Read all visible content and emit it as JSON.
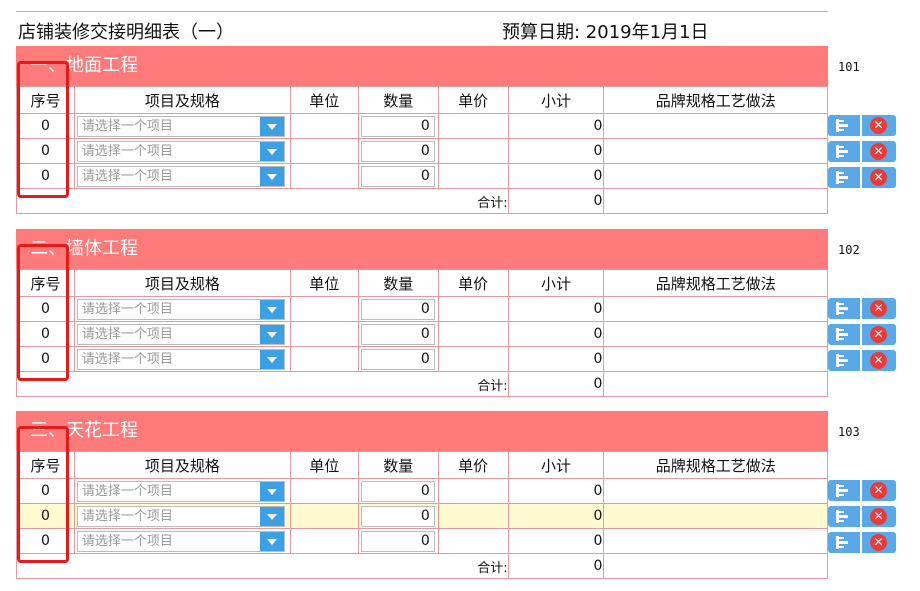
{
  "header": {
    "shop_name": "店铺装修交接明细表（一）",
    "budget_date": "预算日期:  2019年1月1日"
  },
  "columns": [
    "序号",
    "项目及规格",
    "单位",
    "数量",
    "单价",
    "小计",
    "品牌规格工艺做法"
  ],
  "select_placeholder": "请选择一个项目",
  "total_label": "合计:",
  "sections": [
    {
      "title": "一、地面工程",
      "code": "101",
      "rows": [
        {
          "seq": "0",
          "qty": "0",
          "subtotal": "0"
        },
        {
          "seq": "0",
          "qty": "0",
          "subtotal": "0"
        },
        {
          "seq": "0",
          "qty": "0",
          "subtotal": "0"
        }
      ],
      "total": "0"
    },
    {
      "title": "二、墙体工程",
      "code": "102",
      "rows": [
        {
          "seq": "0",
          "qty": "0",
          "subtotal": "0"
        },
        {
          "seq": "0",
          "qty": "0",
          "subtotal": "0"
        },
        {
          "seq": "0",
          "qty": "0",
          "subtotal": "0"
        }
      ],
      "total": "0"
    },
    {
      "title": "三、天花工程",
      "code": "103",
      "rows": [
        {
          "seq": "0",
          "qty": "0",
          "subtotal": "0"
        },
        {
          "seq": "0",
          "qty": "0",
          "subtotal": "0",
          "highlighted": true
        },
        {
          "seq": "0",
          "qty": "0",
          "subtotal": "0"
        }
      ],
      "total": "0"
    }
  ],
  "row_actions": {
    "insert_icon": "insert-row-icon",
    "delete_icon": "delete-row-icon",
    "delete_glyph": "✕"
  },
  "colors": {
    "section_header": "#ff7b7b",
    "grid_border": "#e39aa0",
    "highlight_row": "#fffad0",
    "dropdown_arrow": "#3ea0e4",
    "action_button": "#5aa9e6",
    "delete_circle": "#e83c3c",
    "annotation_box": "#e21b1b"
  }
}
